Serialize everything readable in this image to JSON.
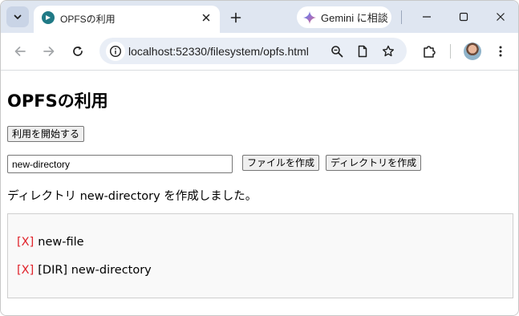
{
  "browser": {
    "tab_title": "OPFSの利用",
    "gemini_label": "Gemini に相談",
    "url": "localhost:52330/filesystem/opfs.html"
  },
  "page": {
    "title": "OPFSの利用",
    "start_button": "利用を開始する",
    "name_input_value": "new-directory",
    "create_file_button": "ファイルを作成",
    "create_dir_button": "ディレクトリを作成",
    "status": "ディレクトリ new-directory を作成しました。",
    "entries": [
      {
        "delete_label": "[X]",
        "name": "new-file"
      },
      {
        "delete_label": "[X]",
        "name": "[DIR] new-directory"
      }
    ]
  },
  "colors": {
    "tabstrip": "#dfe6f1",
    "omnibox": "#e9eef6",
    "delete_link": "#e0222a",
    "list_background": "#f9f9f9"
  }
}
